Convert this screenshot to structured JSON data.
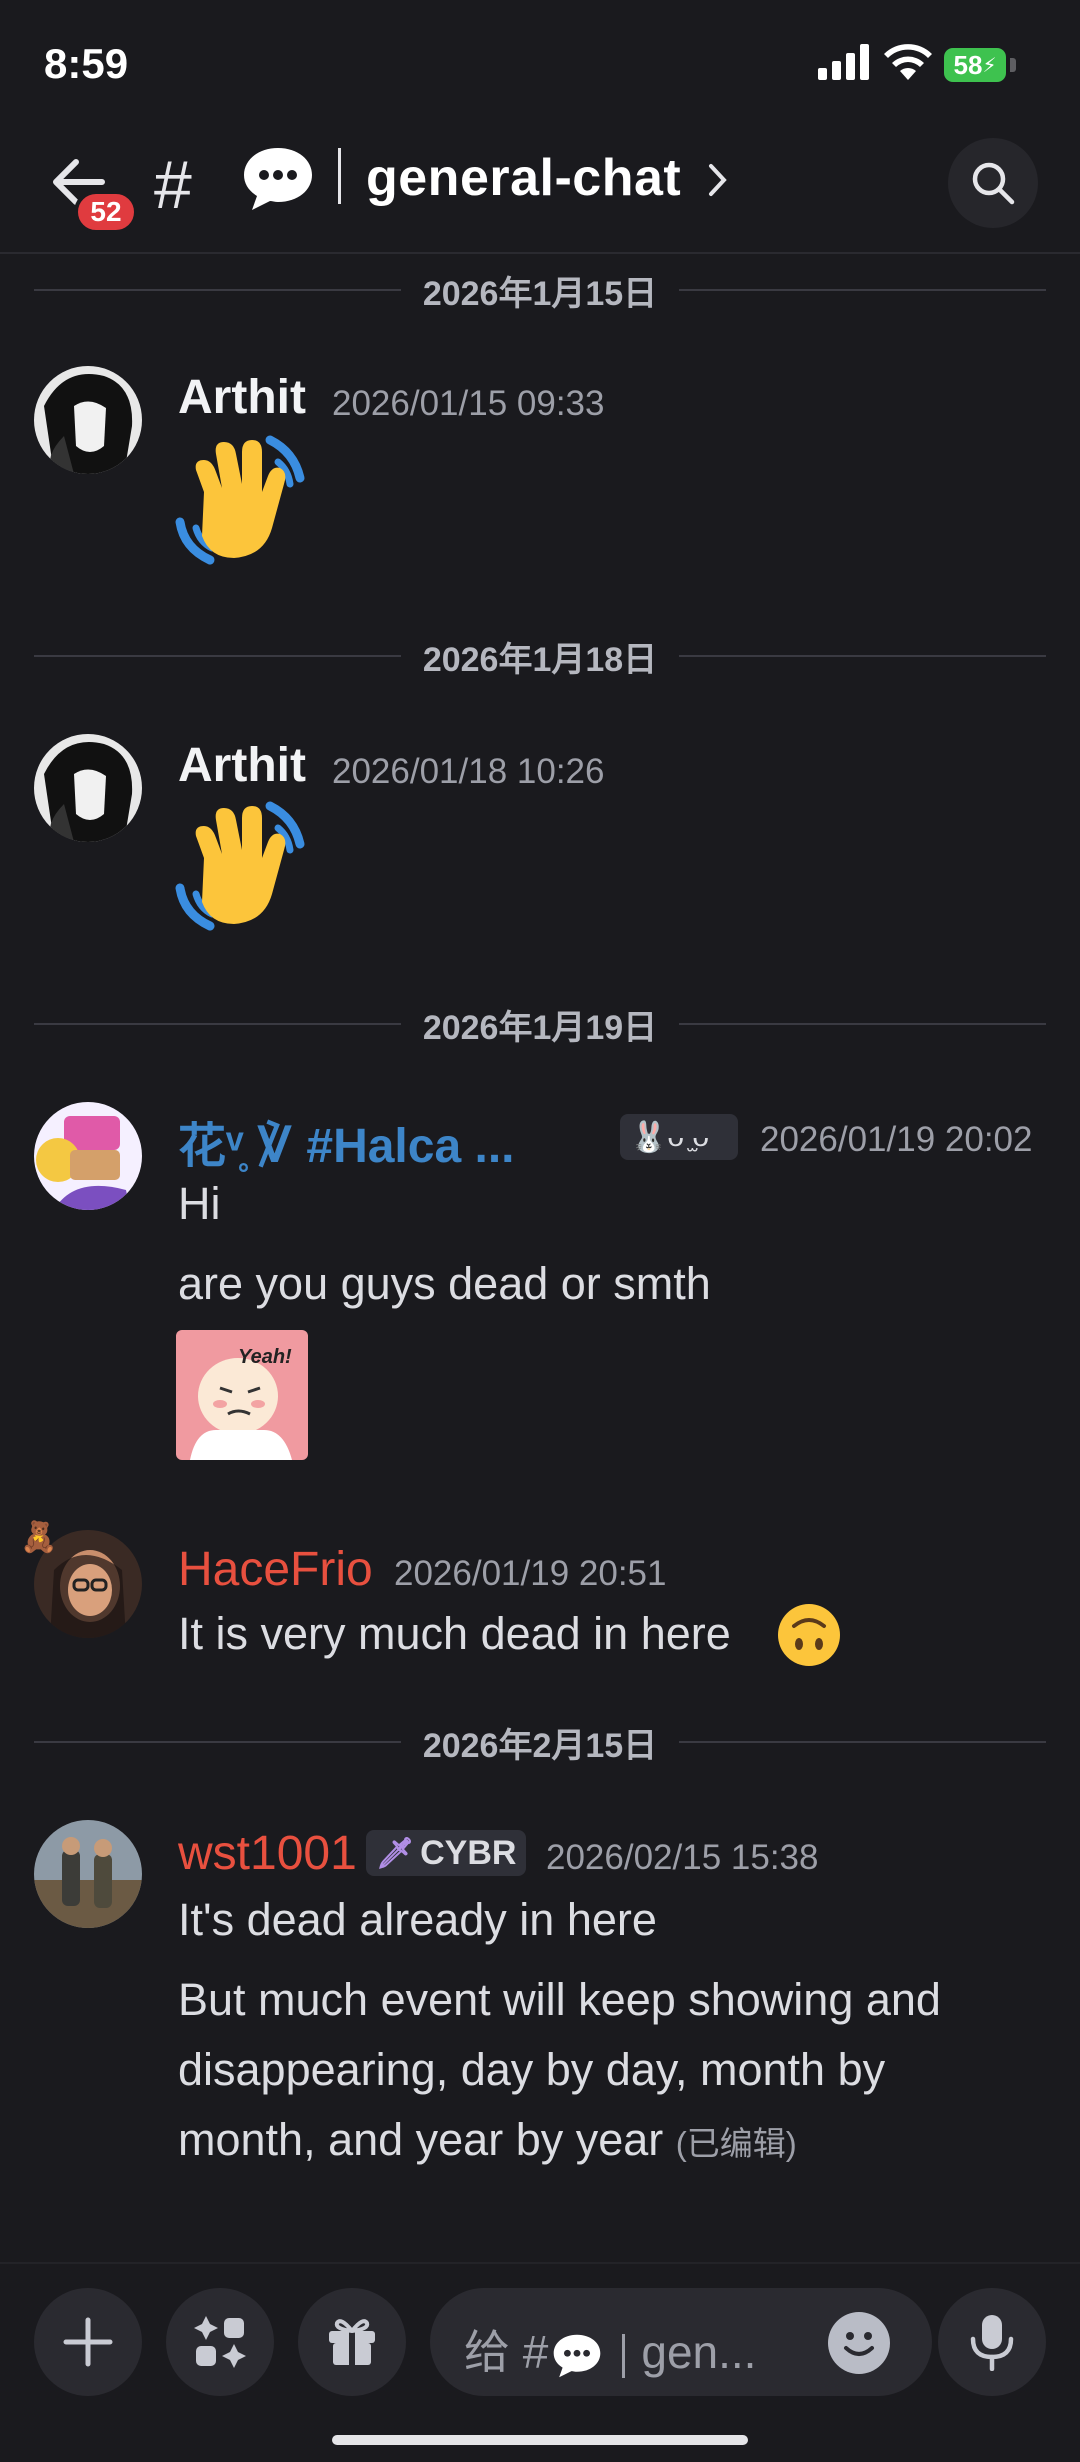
{
  "status": {
    "time": "8:59",
    "battery": "58"
  },
  "header": {
    "unread_badge": "52",
    "channel_name": "general-chat"
  },
  "date_separators": [
    "2026年1月15日",
    "2026年1月18日",
    "2026年1月19日",
    "2026年2月15日"
  ],
  "messages": [
    {
      "author": "Arthit",
      "timestamp": "2026/01/15 09:33",
      "emoji": "wave"
    },
    {
      "author": "Arthit",
      "timestamp": "2026/01/18 10:26",
      "emoji": "wave"
    },
    {
      "author": "花ᵛ̥ ℣ #Halca ...",
      "timestamp": "2026/01/19 20:02",
      "tag": "ᴗ ̫ᴗ",
      "lines": [
        "Hi",
        "are you guys dead or smth"
      ],
      "sticker_text": "Yeah!"
    },
    {
      "author": "HaceFrio",
      "timestamp": "2026/01/19 20:51",
      "lines": [
        "It is very much dead in here"
      ],
      "emoji": "upside-down-face"
    },
    {
      "author": "wst1001",
      "timestamp": "2026/02/15 15:38",
      "tag": "CYBR",
      "lines": [
        "It's dead already in here",
        "But much event will keep showing and",
        "disappearing, day by day, month by",
        "month, and year by year"
      ],
      "edited_label": "(已编辑)"
    }
  ],
  "composer": {
    "placeholder_prefix": "给 #",
    "placeholder_suffix": "gen..."
  },
  "colors": {
    "background": "#1a1a1e",
    "author_blue": "#3d85c8",
    "author_red": "#e8503f",
    "badge_red": "#e03b3f"
  }
}
